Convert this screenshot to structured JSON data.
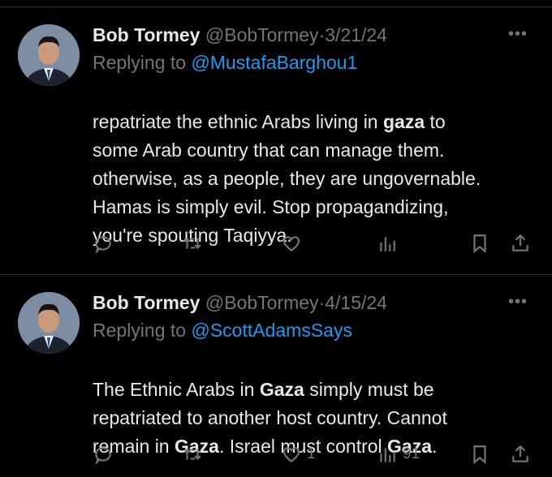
{
  "tweets": [
    {
      "name": "Bob Tormey",
      "handle": "@BobTormey",
      "dot": "·",
      "date": "3/21/24",
      "reply_prefix": "Replying to ",
      "reply_to": "@MustafaBarghou1",
      "body": [
        {
          "text": "repatriate the ethnic Arabs living in ",
          "bold": false
        },
        {
          "text": "gaza",
          "bold": true
        },
        {
          "text": " to\nsome Arab country that can manage them.\notherwise, as a people, they are ungovernable.\nHamas is simply evil. Stop propagandizing,\nyou're spouting Taqiyya.",
          "bold": false
        }
      ],
      "actions": {
        "reply": "",
        "retweet": "",
        "like": "",
        "views": ""
      },
      "more_icon": "more-dots-icon"
    },
    {
      "name": "Bob Tormey",
      "handle": "@BobTormey",
      "dot": "·",
      "date": "4/15/24",
      "reply_prefix": "Replying to ",
      "reply_to": "@ScottAdamsSays",
      "body": [
        {
          "text": "The Ethnic Arabs in ",
          "bold": false
        },
        {
          "text": "Gaza",
          "bold": true
        },
        {
          "text": " simply must be\nrepatriated to another host country. Cannot\nremain in ",
          "bold": false
        },
        {
          "text": "Gaza",
          "bold": true
        },
        {
          "text": ". Israel must control ",
          "bold": false
        },
        {
          "text": "Gaza",
          "bold": true
        },
        {
          "text": ".",
          "bold": false
        }
      ],
      "actions": {
        "reply": "",
        "retweet": "",
        "like": "1",
        "views": "91"
      },
      "more_icon": "more-dots-icon"
    }
  ],
  "colors": {
    "background": "#000000",
    "text": "#e7e9ea",
    "secondary": "#71767b",
    "accent": "#1d9bf0",
    "divider": "#2f3336"
  }
}
